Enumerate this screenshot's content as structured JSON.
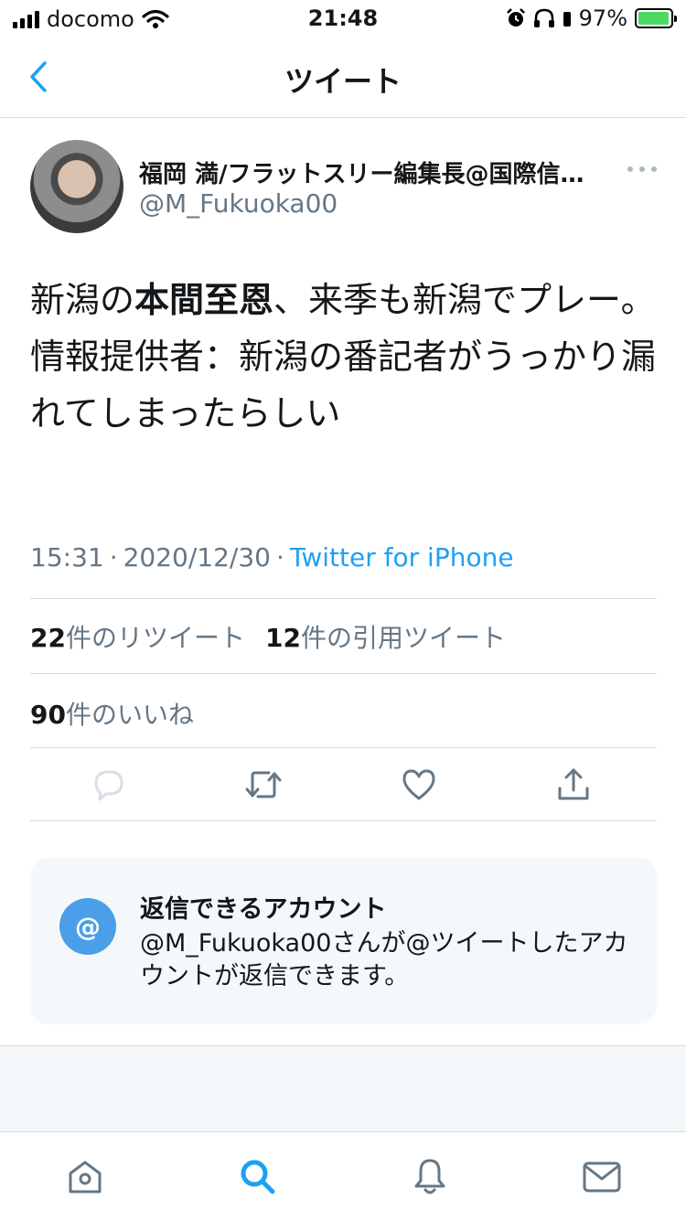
{
  "status_bar": {
    "carrier": "docomo",
    "time": "21:48",
    "battery": "97%"
  },
  "header": {
    "title": "ツイート"
  },
  "tweet": {
    "author_name": "福岡 満/フラットスリー編集長@国際信…",
    "author_handle": "@M_Fukuoka00",
    "text_line1_pre": "新潟の",
    "text_line1_bold": "本間至恩",
    "text_line1_post": "、来季も新潟でプレー。",
    "text_line2": "情報提供者：新潟の番記者がうっかり漏れてしまったらしい",
    "time": "15:31",
    "date": "2020/12/30",
    "separator": "·",
    "source": "Twitter for iPhone"
  },
  "stats": {
    "retweets_count": "22",
    "retweets_label": "件のリツイート",
    "quotes_count": "12",
    "quotes_label": "件の引用ツイート",
    "likes_count": "90",
    "likes_label": "件のいいね"
  },
  "reply_info": {
    "badge": "@",
    "title": "返信できるアカウント",
    "body": "@M_Fukuoka00さんが@ツイートしたアカウントが返信できます。"
  },
  "colors": {
    "accent": "#1da1f2",
    "secondary_text": "#657786",
    "badge": "#4a9fe8"
  },
  "icons": {
    "back": "chevron-left-icon",
    "more": "more-horizontal-icon",
    "reply": "reply-icon",
    "retweet": "retweet-icon",
    "like": "heart-icon",
    "share": "share-icon",
    "home": "home-icon",
    "search": "search-icon",
    "notifications": "bell-icon",
    "messages": "mail-icon"
  }
}
